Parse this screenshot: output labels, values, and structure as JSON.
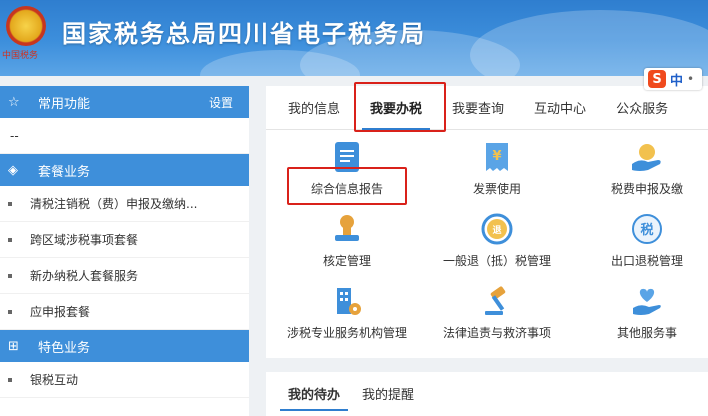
{
  "header": {
    "title": "国家税务总局四川省电子税务局",
    "emblem_text": "中国税务"
  },
  "ime": {
    "logo": "S",
    "lang": "中",
    "dot": "•"
  },
  "sidebar": {
    "common": {
      "title": "常用功能",
      "settings": "设置",
      "icon": "star-icon"
    },
    "common_items": [
      "--"
    ],
    "package": {
      "title": "套餐业务",
      "icon": "layers-icon"
    },
    "package_items": [
      "清税注销税（费）申报及缴纳...",
      "跨区域涉税事项套餐",
      "新办纳税人套餐服务",
      "应申报套餐"
    ],
    "special": {
      "title": "特色业务",
      "icon": "grid-icon"
    },
    "special_items": [
      "银税互动"
    ]
  },
  "tabs": [
    "我的信息",
    "我要办税",
    "我要查询",
    "互动中心",
    "公众服务"
  ],
  "active_tab": "我要办税",
  "services": [
    {
      "label": "综合信息报告",
      "icon": "document-icon",
      "color": "#3e8fda"
    },
    {
      "label": "发票使用",
      "icon": "invoice-icon",
      "color": "#3e8fda"
    },
    {
      "label": "税费申报及缴",
      "icon": "hand-coin-icon",
      "color": "#3e8fda"
    },
    {
      "label": "核定管理",
      "icon": "stamp-icon",
      "color": "#e6a23c"
    },
    {
      "label": "一般退（抵）税管理",
      "icon": "refund-icon",
      "color": "#e6a23c"
    },
    {
      "label": "出口退税管理",
      "icon": "tax-refund-icon",
      "color": "#3e8fda"
    },
    {
      "label": "涉税专业服务机构管理",
      "icon": "building-gear-icon",
      "color": "#3e8fda"
    },
    {
      "label": "法律追责与救济事项",
      "icon": "gavel-icon",
      "color": "#e6a23c"
    },
    {
      "label": "其他服务事",
      "icon": "heart-hand-icon",
      "color": "#3e8fda"
    }
  ],
  "bottom_tabs": [
    "我的待办",
    "我的提醒"
  ],
  "colors": {
    "accent": "#2f7ecf",
    "sidebar_header": "#3e8fda",
    "highlight": "#d9211a"
  }
}
